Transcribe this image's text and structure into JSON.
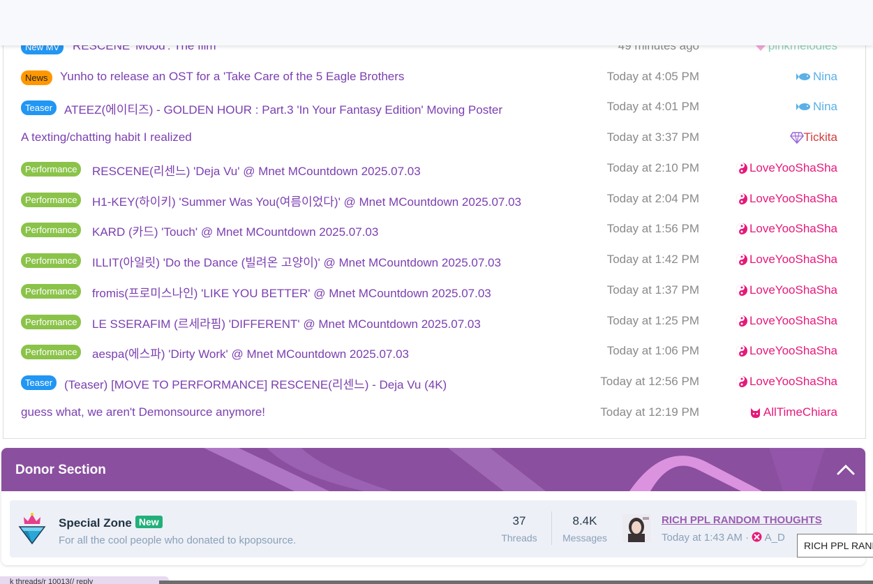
{
  "threads": [
    {
      "prefix": "New MV",
      "prefix_color": "blue",
      "title": "RESCENE 'Mood': The film",
      "time": "49 minutes ago",
      "user": "pinkmelodies",
      "user_color": "#8fd0b8",
      "user_icon": "heart-icon"
    },
    {
      "prefix": "News",
      "prefix_color": "orange",
      "title": "Yunho to release an OST for a 'Take Care of the 5 Eagle Brothers",
      "time": "Today at 4:05 PM",
      "user": "Nina",
      "user_color": "#5bb0e6",
      "user_icon": "fish-icon"
    },
    {
      "prefix": "Teaser",
      "prefix_color": "blue",
      "title": "ATEEZ(에이티즈) - GOLDEN HOUR : Part.3 'In Your Fantasy Edition' Moving Poster",
      "time": "Today at 4:01 PM",
      "user": "Nina",
      "user_color": "#5bb0e6",
      "user_icon": "fish-icon"
    },
    {
      "prefix": "",
      "prefix_color": "",
      "title": "A texting/chatting habit I realized",
      "time": "Today at 3:37 PM",
      "user": "Tickita",
      "user_color": "#d23c3c",
      "user_icon": "diamond-icon"
    },
    {
      "prefix": "Performance",
      "prefix_color": "green",
      "title": "RESCENE(리센느) 'Deja Vu' @ Mnet MCountdown 2025.07.03",
      "time": "Today at 2:10 PM",
      "user": "LoveYooShaSha",
      "user_color": "#e6197a",
      "user_icon": "yinyang-icon"
    },
    {
      "prefix": "Performance",
      "prefix_color": "green",
      "title": "H1-KEY(하이키) 'Summer Was You(여름이었다)' @ Mnet MCountdown 2025.07.03",
      "time": "Today at 2:04 PM",
      "user": "LoveYooShaSha",
      "user_color": "#e6197a",
      "user_icon": "yinyang-icon"
    },
    {
      "prefix": "Performance",
      "prefix_color": "green",
      "title": "KARD (카드) 'Touch' @ Mnet MCountdown 2025.07.03",
      "time": "Today at 1:56 PM",
      "user": "LoveYooShaSha",
      "user_color": "#e6197a",
      "user_icon": "yinyang-icon"
    },
    {
      "prefix": "Performance",
      "prefix_color": "green",
      "title": "ILLIT(아일릿) 'Do the Dance (빌려온 고양이)' @ Mnet MCountdown 2025.07.03",
      "time": "Today at 1:42 PM",
      "user": "LoveYooShaSha",
      "user_color": "#e6197a",
      "user_icon": "yinyang-icon"
    },
    {
      "prefix": "Performance",
      "prefix_color": "green",
      "title": "fromis(프로미스나인) 'LIKE YOU BETTER' @ Mnet MCountdown 2025.07.03",
      "time": "Today at 1:37 PM",
      "user": "LoveYooShaSha",
      "user_color": "#e6197a",
      "user_icon": "yinyang-icon"
    },
    {
      "prefix": "Performance",
      "prefix_color": "green",
      "title": "LE SSERAFIM (르세라핌) 'DIFFERENT' @ Mnet MCountdown 2025.07.03",
      "time": "Today at 1:25 PM",
      "user": "LoveYooShaSha",
      "user_color": "#e6197a",
      "user_icon": "yinyang-icon"
    },
    {
      "prefix": "Performance",
      "prefix_color": "green",
      "title": "aespa(에스파) 'Dirty Work' @ Mnet MCountdown 2025.07.03",
      "time": "Today at 1:06 PM",
      "user": "LoveYooShaSha",
      "user_color": "#e6197a",
      "user_icon": "yinyang-icon"
    },
    {
      "prefix": "Teaser",
      "prefix_color": "blue",
      "title": "(Teaser) [MOVE TO PERFORMANCE] RESCENE(리센느) - Deja Vu (4K)",
      "time": "Today at 12:56 PM",
      "user": "LoveYooShaSha",
      "user_color": "#e6197a",
      "user_icon": "yinyang-icon"
    },
    {
      "prefix": "",
      "prefix_color": "",
      "title": "guess what, we aren't Demonsource anymore!",
      "time": "Today at 12:19 PM",
      "user": "AllTimeChiara",
      "user_color": "#e6197a",
      "user_icon": "cat-icon"
    }
  ],
  "donor": {
    "header": "Donor Section",
    "forum": {
      "name": "Special Zone",
      "badge": "New",
      "description": "For all the cool people who donated to kpopsource.",
      "threads_count": "37",
      "threads_label": "Threads",
      "messages_count": "8.4K",
      "messages_label": "Messages",
      "last_post_title": "RICH PPL RANDOM THOUGHTS",
      "last_post_time": "Today at 1:43 AM",
      "last_post_separator": "·",
      "last_post_user": "A_D"
    }
  },
  "tooltip": "RICH PPL RAND",
  "status_bar": "k       threads/r 10013(/    reply"
}
